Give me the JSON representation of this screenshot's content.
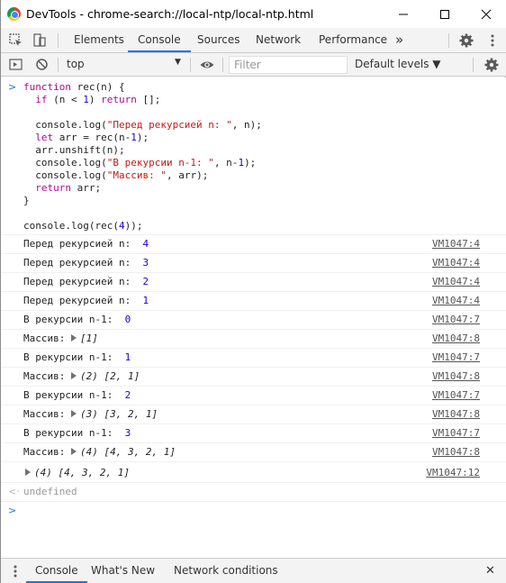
{
  "window": {
    "title": "DevTools - chrome-search://local-ntp/local-ntp.html",
    "minimize_icon": "minimize-icon",
    "maximize_icon": "maximize-icon",
    "close_icon": "close-icon"
  },
  "main_toolbar": {
    "tabs": [
      {
        "label": "Elements",
        "active": false
      },
      {
        "label": "Console",
        "active": true
      },
      {
        "label": "Sources",
        "active": false
      },
      {
        "label": "Network",
        "active": false
      },
      {
        "label": "Performance",
        "active": false
      }
    ],
    "more_tabs": "»"
  },
  "console_toolbar": {
    "context": "top",
    "filter_placeholder": "Filter",
    "levels": "Default levels ▼"
  },
  "code": {
    "l1a": "function",
    "l1b": " rec(n) {",
    "l2a": "  if",
    "l2b": " (n < ",
    "l2c": "1",
    "l2d": ") ",
    "l2e": "return",
    "l2f": " [];",
    "l3a": "  console.log(",
    "l3b": "\"Перед рекурсией n: \"",
    "l3c": ", n);",
    "l4a": "  let",
    "l4b": " arr = rec(n-",
    "l4c": "1",
    "l4d": ");",
    "l5": "  arr.unshift(n);",
    "l6a": "  console.log(",
    "l6b": "\"В рекурсии n-1: \"",
    "l6c": ", n-",
    "l6d": "1",
    "l6e": ");",
    "l7a": "  console.log(",
    "l7b": "\"Массив: \"",
    "l7c": ", arr);",
    "l8a": "  return",
    "l8b": " arr;",
    "l9": "}",
    "l10a": "console.log(rec(",
    "l10b": "4",
    "l10c": "));"
  },
  "logs": [
    {
      "label": "Перед рекурсией n: ",
      "value": "4",
      "src": "VM1047:4"
    },
    {
      "label": "Перед рекурсией n: ",
      "value": "3",
      "src": "VM1047:4"
    },
    {
      "label": "Перед рекурсией n: ",
      "value": "2",
      "src": "VM1047:4"
    },
    {
      "label": "Перед рекурсией n: ",
      "value": "1",
      "src": "VM1047:4"
    },
    {
      "label": "В рекурсии n-1: ",
      "value": "0",
      "src": "VM1047:7"
    },
    {
      "label": "Массив: ",
      "value": "[1]",
      "src": "VM1047:8"
    },
    {
      "label": "В рекурсии n-1: ",
      "value": "1",
      "src": "VM1047:7"
    },
    {
      "label": "Массив: ",
      "value": "(2) [2, 1]",
      "src": "VM1047:8"
    },
    {
      "label": "В рекурсии n-1: ",
      "value": "2",
      "src": "VM1047:7"
    },
    {
      "label": "Массив: ",
      "value": "(3) [3, 2, 1]",
      "src": "VM1047:8"
    },
    {
      "label": "В рекурсии n-1: ",
      "value": "3",
      "src": "VM1047:7"
    },
    {
      "label": "Массив: ",
      "value": "(4) [4, 3, 2, 1]",
      "src": "VM1047:8"
    },
    {
      "label": "",
      "value": "(4) [4, 3, 2, 1]",
      "src": "VM1047:12"
    }
  ],
  "return_value": "undefined",
  "drawer": {
    "tabs": [
      "Console",
      "What's New",
      "Network conditions"
    ],
    "close": "✕"
  }
}
